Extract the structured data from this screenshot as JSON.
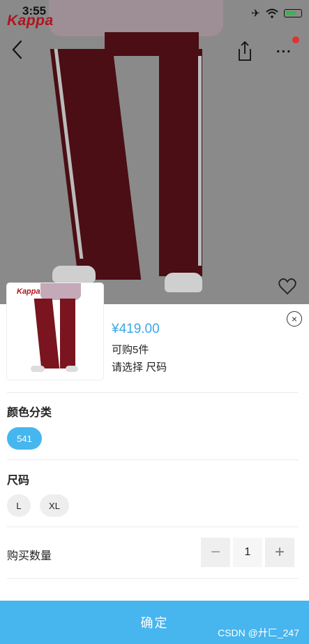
{
  "status_bar": {
    "time": "3:55"
  },
  "brand": {
    "name": "Kappa"
  },
  "nav": {
    "more_label": "..."
  },
  "sheet": {
    "price": "¥419.00",
    "stock": "可购5件",
    "selection_prompt": "请选择 尺码",
    "close_label": "×"
  },
  "color_section": {
    "title": "颜色分类",
    "options": [
      "541"
    ],
    "selected": "541"
  },
  "size_section": {
    "title": "尺码",
    "options": [
      "L",
      "XL"
    ]
  },
  "quantity": {
    "label": "购买数量",
    "minus": "−",
    "value": "1",
    "plus": "+"
  },
  "confirm_button": {
    "label": "确定"
  },
  "watermark": {
    "text": "CSDN @廾匚_247"
  },
  "colors": {
    "accent": "#47b5ee",
    "price": "#3aa8e6",
    "brand": "#b0141f"
  }
}
